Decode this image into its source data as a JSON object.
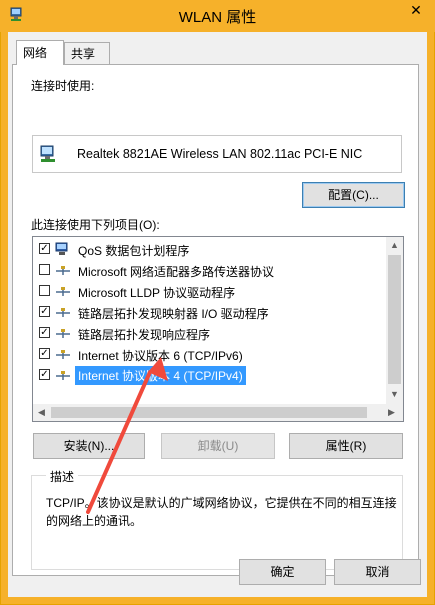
{
  "window": {
    "title": "WLAN 属性"
  },
  "tabs": [
    {
      "label": "网络"
    },
    {
      "label": "共享"
    }
  ],
  "connect_using": {
    "label": "连接时使用:",
    "adapter_name": "Realtek 8821AE Wireless LAN 802.11ac PCI-E NIC",
    "configure_label": "配置(C)..."
  },
  "items_section": {
    "label": "此连接使用下列项目(O):",
    "items": [
      {
        "label": "QoS 数据包计划程序",
        "checked": true,
        "icon": "qos-icon"
      },
      {
        "label": "Microsoft 网络适配器多路传送器协议",
        "checked": false,
        "icon": "protocol-icon"
      },
      {
        "label": "Microsoft LLDP 协议驱动程序",
        "checked": false,
        "icon": "protocol-icon"
      },
      {
        "label": "链路层拓扑发现映射器 I/O 驱动程序",
        "checked": true,
        "icon": "protocol-icon"
      },
      {
        "label": "链路层拓扑发现响应程序",
        "checked": true,
        "icon": "protocol-icon"
      },
      {
        "label": "Internet 协议版本 6 (TCP/IPv6)",
        "checked": true,
        "icon": "protocol-icon"
      },
      {
        "label": "Internet 协议版本 4 (TCP/IPv4)",
        "checked": true,
        "icon": "protocol-icon",
        "selected": true
      }
    ]
  },
  "actions": {
    "install": "安装(N)...",
    "uninstall": "卸载(U)",
    "properties": "属性(R)"
  },
  "description": {
    "legend": "描述",
    "text": "TCP/IP。该协议是默认的广域网络协议，它提供在不同的相互连接的网络上的通讯。"
  },
  "footer": {
    "ok": "确定",
    "cancel": "取消"
  },
  "colors": {
    "titlebar": "#f6b12a",
    "selection": "#3399ff",
    "annotation_arrow": "#f04a3c"
  }
}
